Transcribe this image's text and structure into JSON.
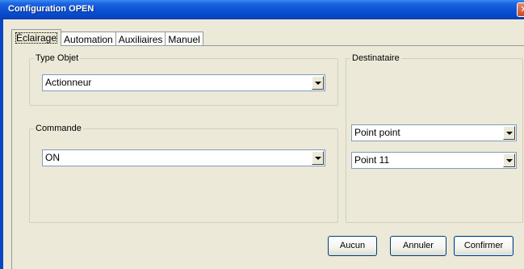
{
  "window": {
    "title": "Configuration OPEN",
    "close_glyph": "✕"
  },
  "tabs": [
    {
      "label": "Éclairage",
      "active": true
    },
    {
      "label": "Automation",
      "active": false
    },
    {
      "label": "Auxiliaires",
      "active": false
    },
    {
      "label": "Manuel",
      "active": false
    }
  ],
  "type_objet": {
    "label": "Type Objet",
    "value": "Actionneur"
  },
  "commande": {
    "label": "Commande",
    "value": "ON"
  },
  "destinataire": {
    "label": "Destinataire",
    "mode": "Point point",
    "point": "Point 11"
  },
  "buttons": {
    "aucun": "Aucun",
    "annuler": "Annuler",
    "confirmer": "Confirmer"
  },
  "colors": {
    "titlebar": "#0A51D6",
    "dialog_bg": "#ECE9D8",
    "field_border": "#7F9DB9",
    "button_border": "#003C74"
  }
}
